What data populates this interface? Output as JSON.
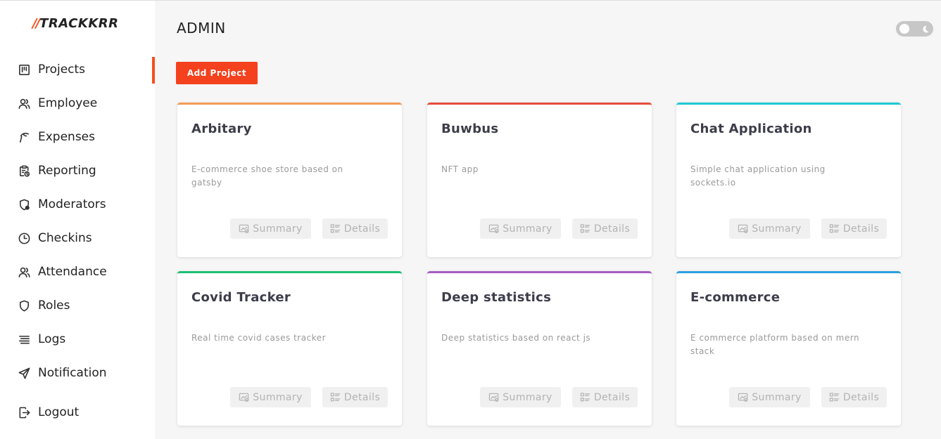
{
  "app": {
    "logo_mark": "//",
    "logo_text": "TRACKKRR",
    "accent": "#f4511e"
  },
  "sidebar": {
    "items": [
      {
        "label": "Projects",
        "icon": "kanban-board-icon",
        "active": true
      },
      {
        "label": "Employee",
        "icon": "users-icon",
        "active": false
      },
      {
        "label": "Expenses",
        "icon": "money-hand-icon",
        "active": false
      },
      {
        "label": "Reporting",
        "icon": "clipboard-clock-icon",
        "active": false
      },
      {
        "label": "Moderators",
        "icon": "shield-user-icon",
        "active": false
      },
      {
        "label": "Checkins",
        "icon": "clock-icon",
        "active": false
      },
      {
        "label": "Attendance",
        "icon": "users-icon",
        "active": false
      },
      {
        "label": "Roles",
        "icon": "shield-icon",
        "active": false
      },
      {
        "label": "Logs",
        "icon": "lines-icon",
        "active": false
      },
      {
        "label": "Notification",
        "icon": "send-icon",
        "active": false
      },
      {
        "label": "Logout",
        "icon": "logout-icon",
        "active": false
      }
    ]
  },
  "header": {
    "title": "ADMIN",
    "theme_toggle_icon": "moon-icon"
  },
  "toolbar": {
    "add_label": "Add Project"
  },
  "projects": [
    {
      "title": "Arbitary",
      "description": "E-commerce shoe store based on gatsby",
      "color": "#f39c57"
    },
    {
      "title": "Buwbus",
      "description": "NFT app",
      "color": "#e74c3c"
    },
    {
      "title": "Chat Application",
      "description": "Simple chat application using sockets.io",
      "color": "#1fc8d4"
    },
    {
      "title": "Covid Tracker",
      "description": "Real time covid cases tracker",
      "color": "#1dbf73"
    },
    {
      "title": "Deep statistics",
      "description": "Deep statistics based on react js",
      "color": "#a65ec2"
    },
    {
      "title": "E-commerce",
      "description": "E commerce platform based on mern stack",
      "color": "#2e9fe0"
    }
  ],
  "card_actions": {
    "summary_label": "Summary",
    "details_label": "Details"
  }
}
